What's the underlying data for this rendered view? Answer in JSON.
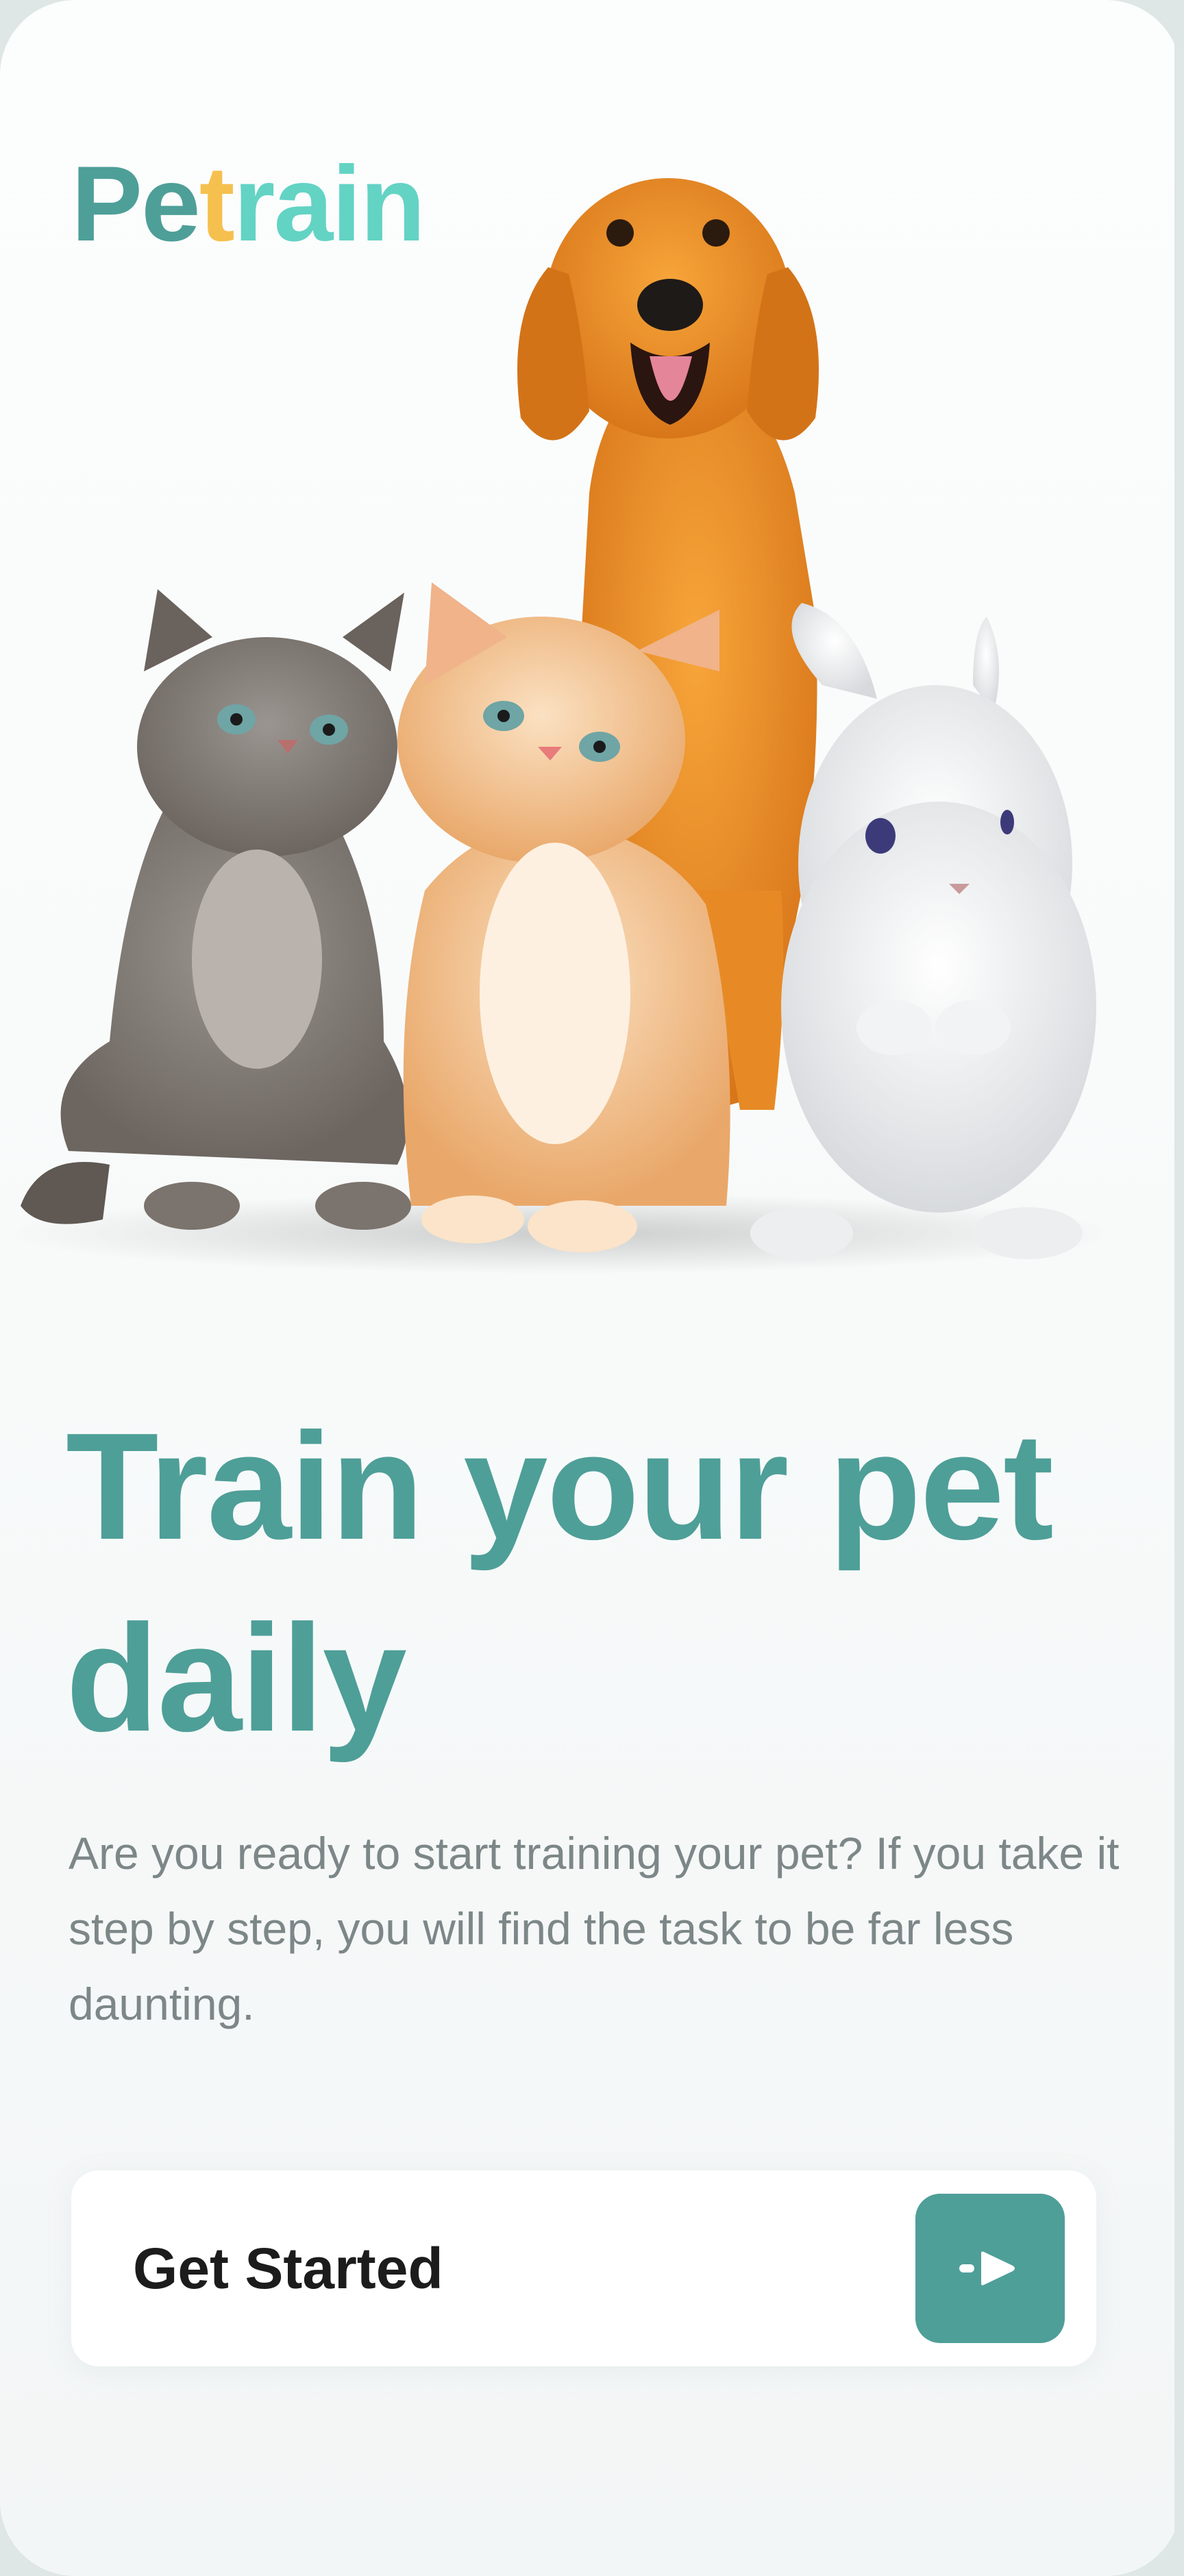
{
  "app": {
    "logo": {
      "part1": "Pe",
      "part2": "t",
      "part3": "rain"
    }
  },
  "hero": {
    "image": "dog-cats-rabbit-illustration"
  },
  "onboarding": {
    "headline": "Train your pet daily",
    "description": "Are you ready to start training your pet? If you take it step by step, you will find the task to be far less daunting."
  },
  "cta": {
    "label": "Get Started",
    "icon": "arrow-right-icon"
  },
  "colors": {
    "accent": "#4e9f98",
    "logo_yellow": "#f5c04e",
    "logo_teal_light": "#63d3c4",
    "text_muted": "#7d8788",
    "text_dark": "#1c1c1c"
  }
}
